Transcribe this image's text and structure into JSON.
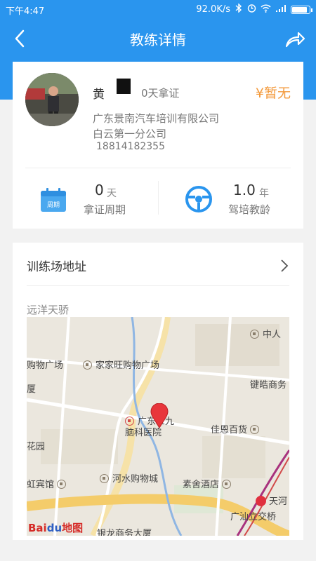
{
  "status_bar": {
    "time": "下午4:47",
    "speed": "92.0K/s"
  },
  "nav": {
    "title": "教练详情",
    "back_icon": "back-arrow-icon",
    "share_icon": "share-icon"
  },
  "profile": {
    "name_visible_char": "黄",
    "days_to_cert": "0天拿证",
    "price": "¥暂无",
    "company_line1": "广东景南汽车培训有限公司",
    "company_line2": "白云第一分公司",
    "phone": "18814182355"
  },
  "stats": [
    {
      "icon": "calendar-icon",
      "icon_text": "周期",
      "value": "0",
      "unit": "天",
      "label": "拿证周期"
    },
    {
      "icon": "steering-wheel-icon",
      "value": "1.0",
      "unit": "年",
      "label": "驾培教龄"
    }
  ],
  "address": {
    "title": "训练场地址",
    "place": "远洋天骄",
    "map_labels": {
      "zhongren": "中人",
      "mall1": "购物广场",
      "jiajiawang": "家家旺购物广场",
      "sha": "厦",
      "jianhao": "键皓商务",
      "hospital": "广东三九脑科医院",
      "jiaen": "佳恩百货",
      "huayuan": "花园",
      "hongbinguan": "虹宾馆",
      "heshui": "河水购物城",
      "sushe": "素舍酒店",
      "tianhe": "天河",
      "guangshan": "广汕立交桥",
      "yinlong": "银龙商务大厦",
      "baidu_bai": "Bai",
      "baidu_du": "du",
      "baidu_map": "地图"
    }
  },
  "colors": {
    "brand": "#2a95ee",
    "price": "#f39a3c",
    "pin": "#e8363b"
  }
}
